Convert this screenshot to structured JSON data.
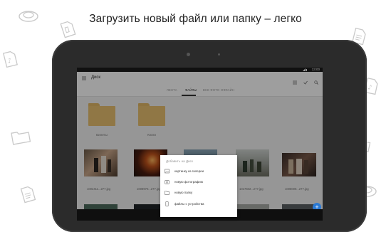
{
  "headline": "Загрузить новый файл или папку – легко",
  "device": {
    "status_time": "13:00",
    "app_title": "Диск",
    "tabs": [
      {
        "label": "ЛЕНТА",
        "active": false
      },
      {
        "label": "ФАЙЛЫ",
        "active": true
      },
      {
        "label": "ВСЕ ФОТО",
        "active": false
      },
      {
        "label": "ОФЛАЙН",
        "active": false
      }
    ],
    "folders": [
      {
        "label": "Билеты"
      },
      {
        "label": "Книги"
      }
    ],
    "files": [
      {
        "label": "1002411...277.jpg"
      },
      {
        "label": "1008970...277.jpg"
      },
      {
        "label": ""
      },
      {
        "label": "1017502...277.jpg"
      },
      {
        "label": "1008009...277.jpg"
      }
    ],
    "add_sheet": {
      "title": "Добавить на Диск",
      "items": [
        {
          "label": "картинку из галереи",
          "icon": "gallery-icon"
        },
        {
          "label": "новую фотографию",
          "icon": "camera-icon"
        },
        {
          "label": "новую папку",
          "icon": "folder-icon"
        },
        {
          "label": "файлы с устройства",
          "icon": "device-icon"
        }
      ]
    },
    "fab_symbol": "+"
  },
  "colors": {
    "folder": "#e8c070",
    "fab": "#2a79d4",
    "tablet_bezel": "#2b2b2b"
  }
}
